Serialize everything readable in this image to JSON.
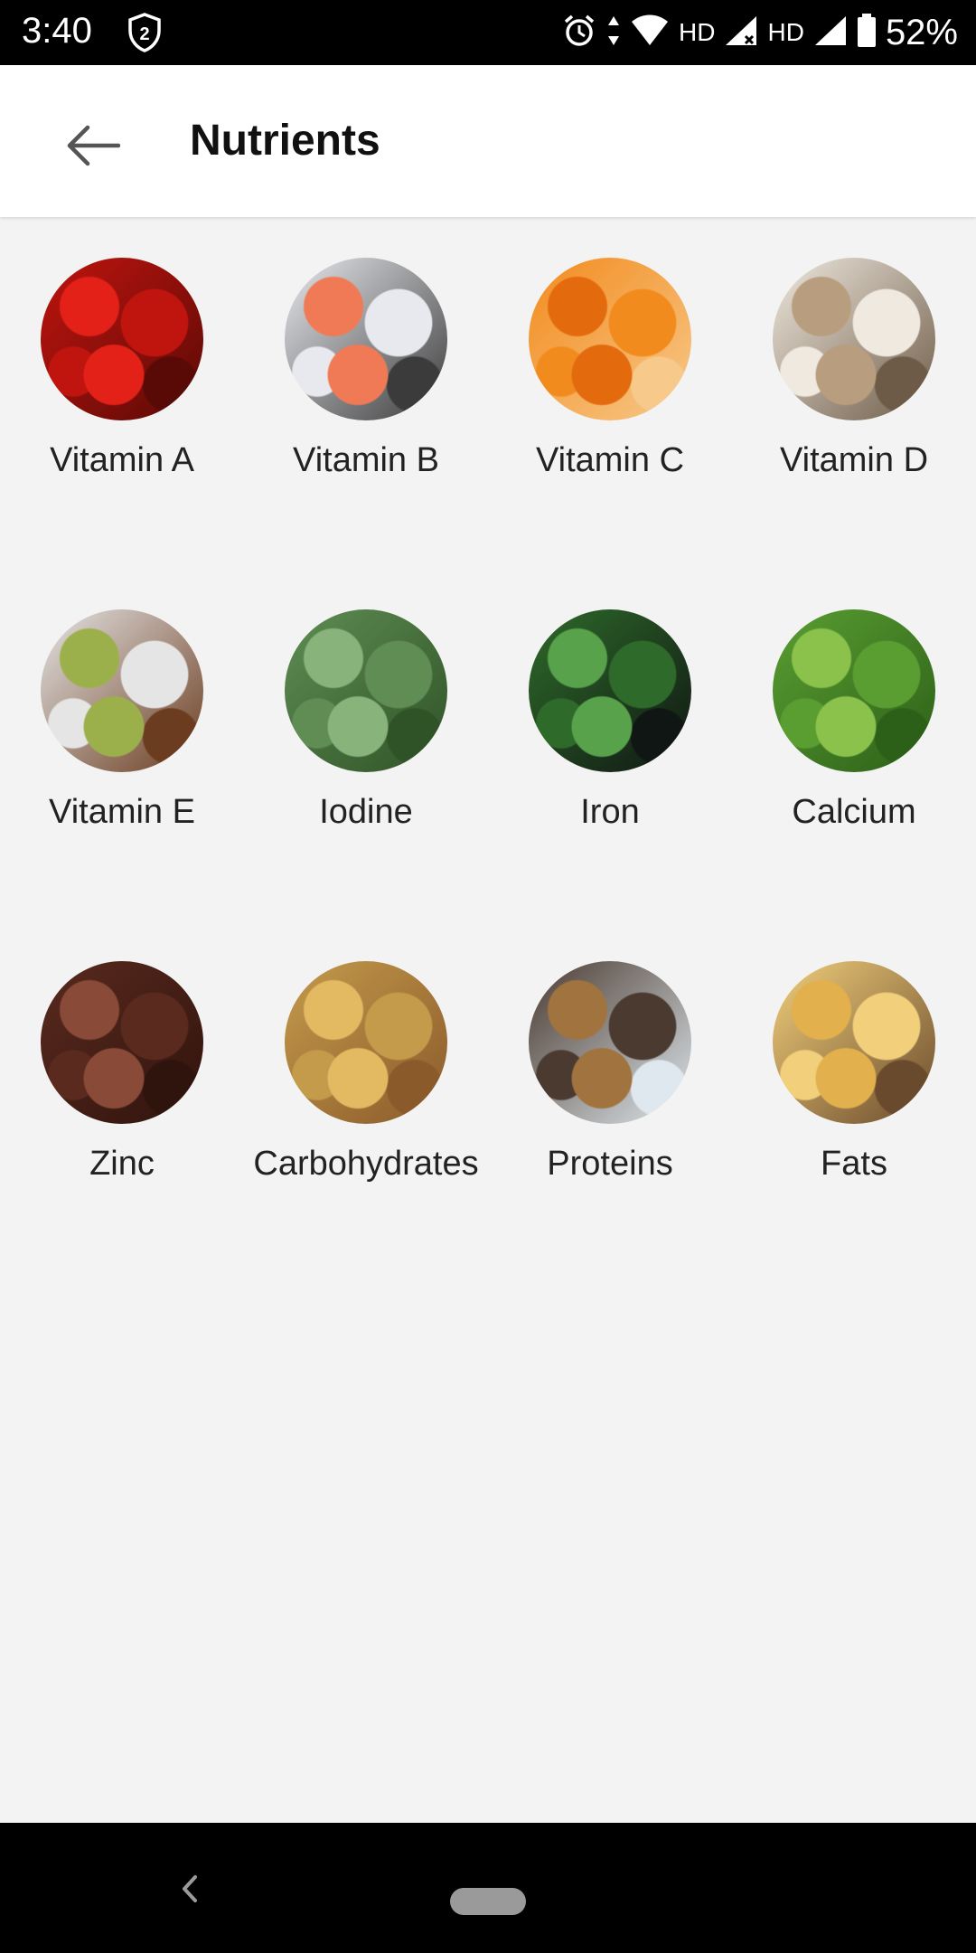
{
  "status_bar": {
    "time": "3:40",
    "shield_badge": "2",
    "hd_1": "HD",
    "hd_2": "HD",
    "battery": "52%",
    "icons": [
      "shield-icon",
      "alarm-icon",
      "data-arrows-icon",
      "wifi-icon",
      "signal-icon",
      "battery-icon"
    ]
  },
  "app_bar": {
    "title": "Nutrients",
    "back_icon": "arrow-left-icon"
  },
  "nutrients": [
    {
      "label": "Vitamin A",
      "image": "red-bell-peppers",
      "colors": [
        "#c0140e",
        "#e32118",
        "#5a0a06"
      ]
    },
    {
      "label": "Vitamin B",
      "image": "salmon-fillet",
      "colors": [
        "#e8e9ee",
        "#f07a55",
        "#3b3b3b"
      ]
    },
    {
      "label": "Vitamin C",
      "image": "mandarin-oranges",
      "colors": [
        "#f28b1e",
        "#e36a0d",
        "#f7c98a"
      ]
    },
    {
      "label": "Vitamin D",
      "image": "mushrooms",
      "colors": [
        "#efe9df",
        "#b89e7e",
        "#6e5b47"
      ]
    },
    {
      "label": "Vitamin E",
      "image": "avocado",
      "colors": [
        "#e5e5e5",
        "#9bb04b",
        "#6b3c1f"
      ]
    },
    {
      "label": "Iodine",
      "image": "green-beans",
      "colors": [
        "#5f8d54",
        "#88b37a",
        "#2f5226"
      ]
    },
    {
      "label": "Iron",
      "image": "spinach",
      "colors": [
        "#2e6b2a",
        "#58a24c",
        "#101613"
      ]
    },
    {
      "label": "Calcium",
      "image": "broccoli",
      "colors": [
        "#5a9e32",
        "#8bc24c",
        "#2c5f18"
      ]
    },
    {
      "label": "Zinc",
      "image": "flax-seeds",
      "colors": [
        "#5a2a1e",
        "#8a4a38",
        "#2f130d"
      ]
    },
    {
      "label": "Carbohydrates",
      "image": "grains-mix",
      "colors": [
        "#c49a4b",
        "#e3b962",
        "#8a5a2b"
      ]
    },
    {
      "label": "Proteins",
      "image": "egg-basket",
      "colors": [
        "#4a3a30",
        "#a0733f",
        "#dfe8ee"
      ]
    },
    {
      "label": "Fats",
      "image": "cheese",
      "colors": [
        "#f1cf7b",
        "#e2b04d",
        "#6a4a2c"
      ]
    }
  ],
  "nav_bar": {
    "back_icon": "nav-back-icon",
    "home_icon": "nav-home-pill"
  }
}
